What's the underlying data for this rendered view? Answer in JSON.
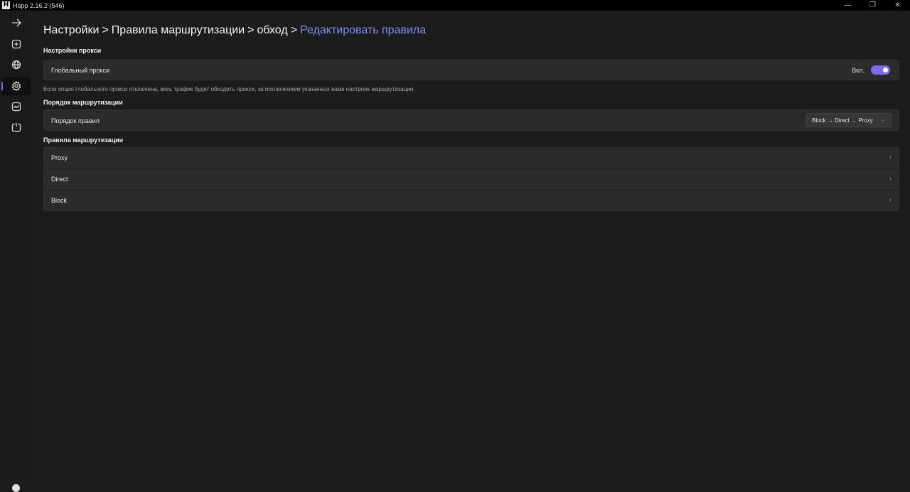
{
  "window": {
    "title": "Happ 2.16.2 (546)",
    "logo_letter": "H",
    "controls": [
      "—",
      "❐",
      "✕"
    ]
  },
  "sidebar": {
    "items": [
      {
        "name": "arrow-right-icon",
        "active": false
      },
      {
        "name": "add-square-icon",
        "active": false
      },
      {
        "name": "globe-icon",
        "active": false
      },
      {
        "name": "gear-icon",
        "active": true
      },
      {
        "name": "activity-chart-icon",
        "active": false
      },
      {
        "name": "power-icon",
        "active": false
      }
    ],
    "accent_color": "#7b6cf0"
  },
  "breadcrumb": {
    "items": [
      "Настройки",
      "Правила маршрутизации",
      "обход"
    ],
    "separator": ">",
    "current": "Редактировать правила"
  },
  "proxy_settings": {
    "section_title": "Настройки прокси",
    "global_proxy_label": "Глобальный прокси",
    "toggle_text": "Вкл.",
    "toggle_on": true,
    "hint": "Если опция глобального прокси отключена, весь трафик будет обходить прокси, за исключением указанных вами настроек маршрутизации."
  },
  "routing_order": {
    "section_title": "Порядок маршрутизации",
    "label": "Порядок правил",
    "selected_value": "Block → Direct → Proxy",
    "chevron": "⌵"
  },
  "routing_rules": {
    "section_title": "Правила маршрутизации",
    "rows": [
      {
        "label": "Proxy"
      },
      {
        "label": "Direct"
      },
      {
        "label": "Block"
      }
    ],
    "chevron": "›"
  }
}
